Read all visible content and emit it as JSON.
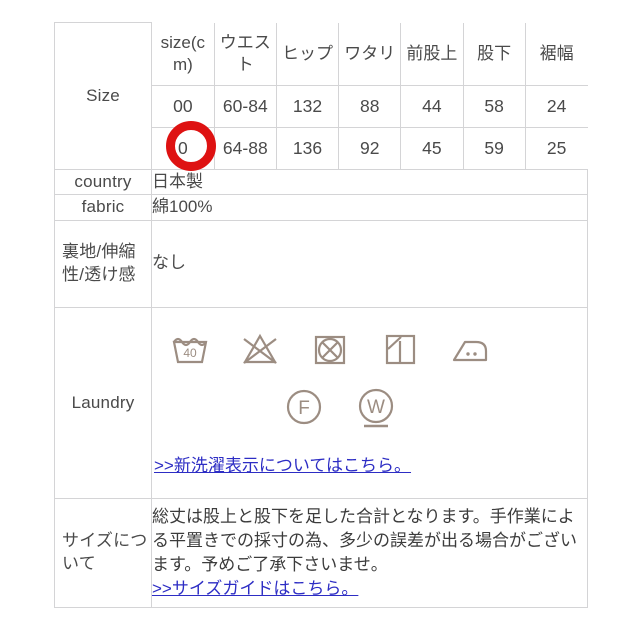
{
  "table": {
    "size_section": {
      "label": "Size",
      "columns": [
        "size(cm)",
        "ウエスト",
        "ヒップ",
        "ワタリ",
        "前股上",
        "股下",
        "裾幅"
      ],
      "rows": [
        {
          "size": "00",
          "waist": "60-84",
          "hip": "132",
          "thigh": "88",
          "rise": "44",
          "inseam": "58",
          "hem": "24"
        },
        {
          "size": "0",
          "waist": "64-88",
          "hip": "136",
          "thigh": "92",
          "rise": "45",
          "inseam": "59",
          "hem": "25"
        }
      ]
    },
    "country": {
      "label": "country",
      "value": "日本製"
    },
    "fabric": {
      "label": "fabric",
      "value": "綿100%"
    },
    "lining": {
      "label": "裏地/伸縮性/透け感",
      "value": "なし"
    },
    "laundry": {
      "label": "Laundry",
      "symbols_row1": [
        "wash-40-icon",
        "no-bleach-icon",
        "no-tumble-dry-icon",
        "line-dry-shade-icon",
        "iron-two-dots-icon"
      ],
      "symbols_row2": [
        "dryclean-f-icon",
        "wetclean-w-icon"
      ],
      "wash_temp": "40",
      "dryclean_letter": "F",
      "wetclean_letter": "W",
      "link_text": ">>新洗濯表示についてはこちら。"
    },
    "size_note": {
      "label": "サイズについて",
      "paragraph": "総丈は股上と股下を足した合計となります。手作業による平置きでの採寸の為、多少の誤差が出る場合がございます。予めご了承下さいませ。",
      "link_text": ">>サイズガイドはこちら。"
    }
  },
  "annotation": {
    "circle_target": "0",
    "circle_color": "#de1212"
  }
}
